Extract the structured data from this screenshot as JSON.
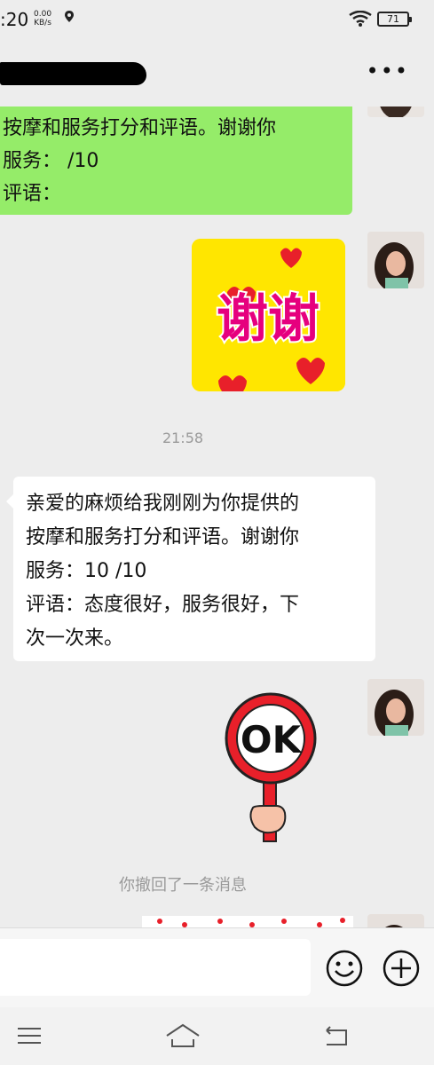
{
  "status_bar": {
    "time": ":20",
    "net_speed_value": "0.00",
    "net_speed_unit": "KB/s",
    "battery": "71"
  },
  "header": {
    "contact_name": "",
    "more_icon": "more-horizontal-icon"
  },
  "messages": [
    {
      "type": "text",
      "side": "left-green",
      "lines": [
        "按摩和服务打分和评语。谢谢你",
        "服务： /10",
        "评语："
      ]
    },
    {
      "type": "sticker",
      "side": "right",
      "sticker_text": "谢谢"
    },
    {
      "type": "time",
      "text": "21:58"
    },
    {
      "type": "text",
      "side": "left",
      "lines": [
        "亲爱的麻烦给我刚刚为你提供的",
        "按摩和服务打分和评语。谢谢你",
        "服务：10 /10",
        "评语：态度很好，服务很好，下",
        "次一次来。"
      ]
    },
    {
      "type": "sticker",
      "side": "right",
      "sticker_text": "OK"
    },
    {
      "type": "system",
      "text": "你撤回了一条消息"
    }
  ],
  "input": {
    "placeholder": "",
    "emoji_icon": "smiley-icon",
    "more_icon": "plus-circle-icon"
  },
  "nav": {
    "menu_icon": "menu-icon",
    "home_icon": "home-icon",
    "back_icon": "back-icon"
  },
  "colors": {
    "background": "#ededed",
    "green_bubble": "#95ec69",
    "white_bubble": "#ffffff",
    "sticker_yellow": "#ffe600",
    "sticker_pink": "#e6007e",
    "system_text": "#9a9a9a"
  }
}
